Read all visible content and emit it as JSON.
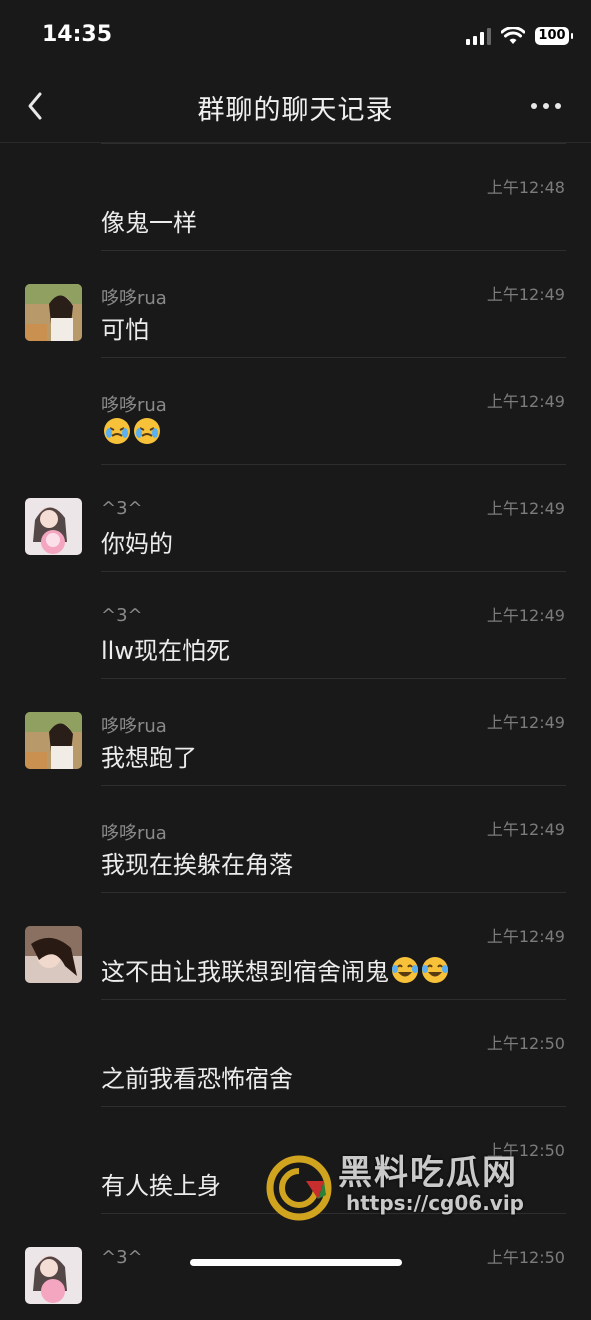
{
  "status_bar": {
    "time": "14:35",
    "battery": "100"
  },
  "nav": {
    "title": "群聊的聊天记录"
  },
  "messages": [
    {
      "sender": "",
      "time": "上午12:48",
      "text": "像鬼一样",
      "avatar": null,
      "emoji": 0
    },
    {
      "sender": "哆哆rua",
      "time": "上午12:49",
      "text": "可怕",
      "avatar": "girl-photo-avatar-1",
      "emoji": 0
    },
    {
      "sender": "哆哆rua",
      "time": "上午12:49",
      "text": "",
      "avatar": null,
      "emoji": 2
    },
    {
      "sender": "^3^",
      "time": "上午12:49",
      "text": "你妈的",
      "avatar": "girl-with-plush-avatar",
      "emoji": 0
    },
    {
      "sender": "^3^",
      "time": "上午12:49",
      "text": "llw现在怕死",
      "avatar": null,
      "emoji": 0
    },
    {
      "sender": "哆哆rua",
      "time": "上午12:49",
      "text": "我想跑了",
      "avatar": "girl-photo-avatar-1",
      "emoji": 0
    },
    {
      "sender": "哆哆rua",
      "time": "上午12:49",
      "text": "我现在挨躲在角落",
      "avatar": null,
      "emoji": 0
    },
    {
      "sender": "",
      "time": "上午12:49",
      "text": "这不由让我联想到宿舍闹鬼",
      "avatar": "girl-lying-avatar",
      "emoji": 2
    },
    {
      "sender": "",
      "time": "上午12:50",
      "text": "之前我看恐怖宿舍",
      "avatar": null,
      "emoji": 0
    },
    {
      "sender": "",
      "time": "上午12:50",
      "text": "有人挨上身",
      "avatar": null,
      "emoji": 0
    },
    {
      "sender": "^3^",
      "time": "上午12:50",
      "text": "",
      "avatar": "girl-with-plush-avatar",
      "emoji": 0
    }
  ],
  "watermark": {
    "name": "黑料吃瓜网",
    "url": "https://cg06.vip"
  },
  "colors": {
    "background": "#191919",
    "text": "#ececec",
    "secondary": "#8a8a8a"
  }
}
